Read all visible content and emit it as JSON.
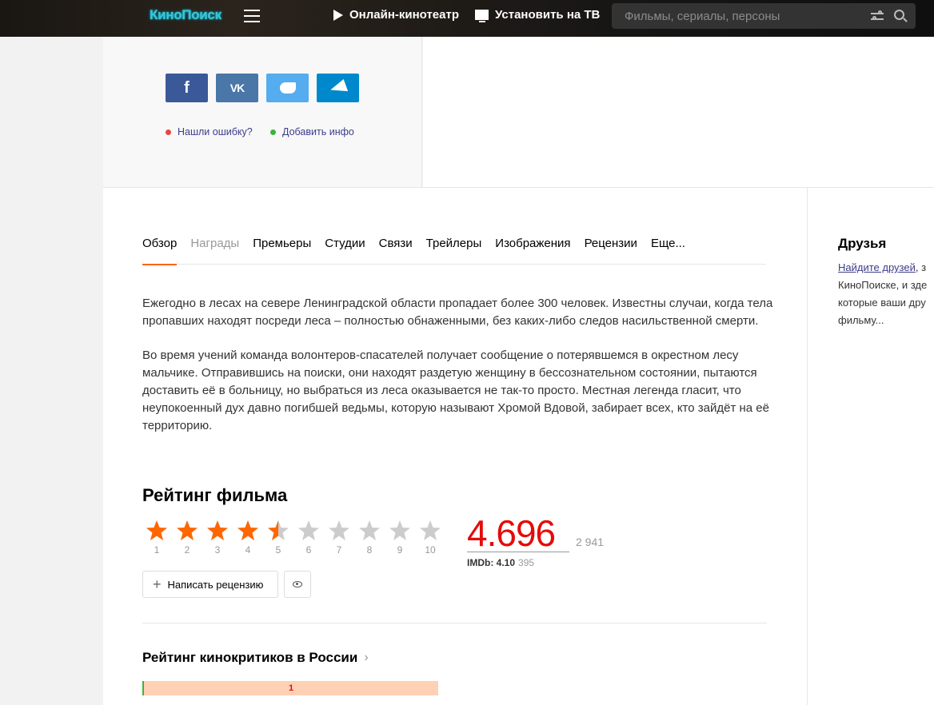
{
  "header": {
    "logo": "КиноПоиск",
    "nav_online": "Онлайн-кинотеатр",
    "nav_tv": "Установить на ТВ",
    "search_placeholder": "Фильмы, сериалы, персоны"
  },
  "share": {
    "facebook": "f",
    "vk": "VK",
    "error_link": "Нашли ошибку?",
    "add_info_link": "Добавить инфо",
    "colors": {
      "facebook": "#3b5999",
      "vk": "#4a76a8",
      "twitter": "#55acee",
      "telegram": "#0088cc",
      "error_dot": "#e84545",
      "add_dot": "#3bb33b"
    }
  },
  "tabs": [
    {
      "label": "Обзор",
      "active": true
    },
    {
      "label": "Награды",
      "muted": true
    },
    {
      "label": "Премьеры"
    },
    {
      "label": "Студии"
    },
    {
      "label": "Связи"
    },
    {
      "label": "Трейлеры"
    },
    {
      "label": "Изображения"
    },
    {
      "label": "Рецензии"
    },
    {
      "label": "Еще..."
    }
  ],
  "synopsis": {
    "p1": "Ежегодно в лесах на севере Ленинградской области пропадает более 300 человек. Известны случаи, когда тела пропавших находят посреди леса – полностью обнаженными, без каких-либо следов насильственной смерти.",
    "p2": "Во время учений команда волонтеров-спасателей получает сообщение о потерявшемся в окрестном лесу мальчике. Отправившись на поиски, они находят раздетую женщину в бессознательном состоянии, пытаются доставить её в больницу, но выбраться из леса оказывается не так-то просто. Местная легенда гласит, что неупокоенный дух давно погибшей ведьмы, которую называют Хромой Вдовой, забирает всех, кто зайдёт на её территорию."
  },
  "rating": {
    "title": "Рейтинг фильма",
    "stars": [
      "1",
      "2",
      "3",
      "4",
      "5",
      "6",
      "7",
      "8",
      "9",
      "10"
    ],
    "filled": 4.5,
    "value": "4.696",
    "votes": "2 941",
    "imdb_label": "IMDb: 4.10",
    "imdb_votes": "395",
    "write_review": "Написать рецензию",
    "star_color": "#f60",
    "star_empty_color": "#ccc"
  },
  "critics": {
    "title": "Рейтинг кинокритиков в России",
    "bar_label": "1"
  },
  "friends": {
    "title": "Друзья",
    "link": "Найдите друзей",
    "text_1": ", з",
    "text_2": "КиноПоиске, и зде",
    "text_3": "которые ваши дру",
    "text_4": "фильму..."
  }
}
